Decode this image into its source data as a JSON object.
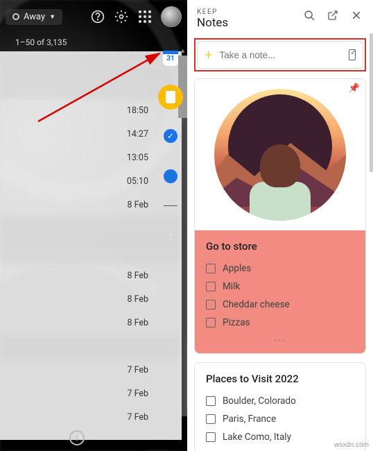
{
  "gmail": {
    "status_label": "Away",
    "count_text": "1–50 of 3,135",
    "rows": [
      {
        "time": "",
        "blur": true
      },
      {
        "time": "",
        "blur": true
      },
      {
        "time": "18:50",
        "blur": false
      },
      {
        "time": "14:27",
        "blur": false
      },
      {
        "time": "13:05",
        "blur": false
      },
      {
        "time": "05:10",
        "blur": false
      },
      {
        "time": "8 Feb",
        "blur": false
      },
      {
        "time": "",
        "blur": true
      },
      {
        "time": "",
        "blur": true
      },
      {
        "time": "8 Feb",
        "blur": false
      },
      {
        "time": "8 Feb",
        "blur": false
      },
      {
        "time": "8 Feb",
        "blur": false
      },
      {
        "time": "",
        "blur": true
      },
      {
        "time": "7 Feb",
        "blur": false
      },
      {
        "time": "7 Feb",
        "blur": false
      },
      {
        "time": "7 Feb",
        "blur": false
      }
    ],
    "calendar_day": "31"
  },
  "keep": {
    "header_small": "KEEP",
    "header_large": "Notes",
    "input_placeholder": "Take a note...",
    "cards": [
      {
        "title": "Go to store",
        "pinned": true,
        "color": "salmon",
        "has_image": true,
        "items": [
          "Apples",
          "Milk",
          "Cheddar cheese",
          "Pizzas"
        ],
        "truncated": true
      },
      {
        "title": "Places to Visit 2022",
        "pinned": false,
        "color": "white",
        "has_image": false,
        "items": [
          "Boulder, Colorado",
          "Paris, France",
          "Lake Como, Italy"
        ],
        "truncated": false
      }
    ]
  },
  "watermark": "wsxdn.com"
}
